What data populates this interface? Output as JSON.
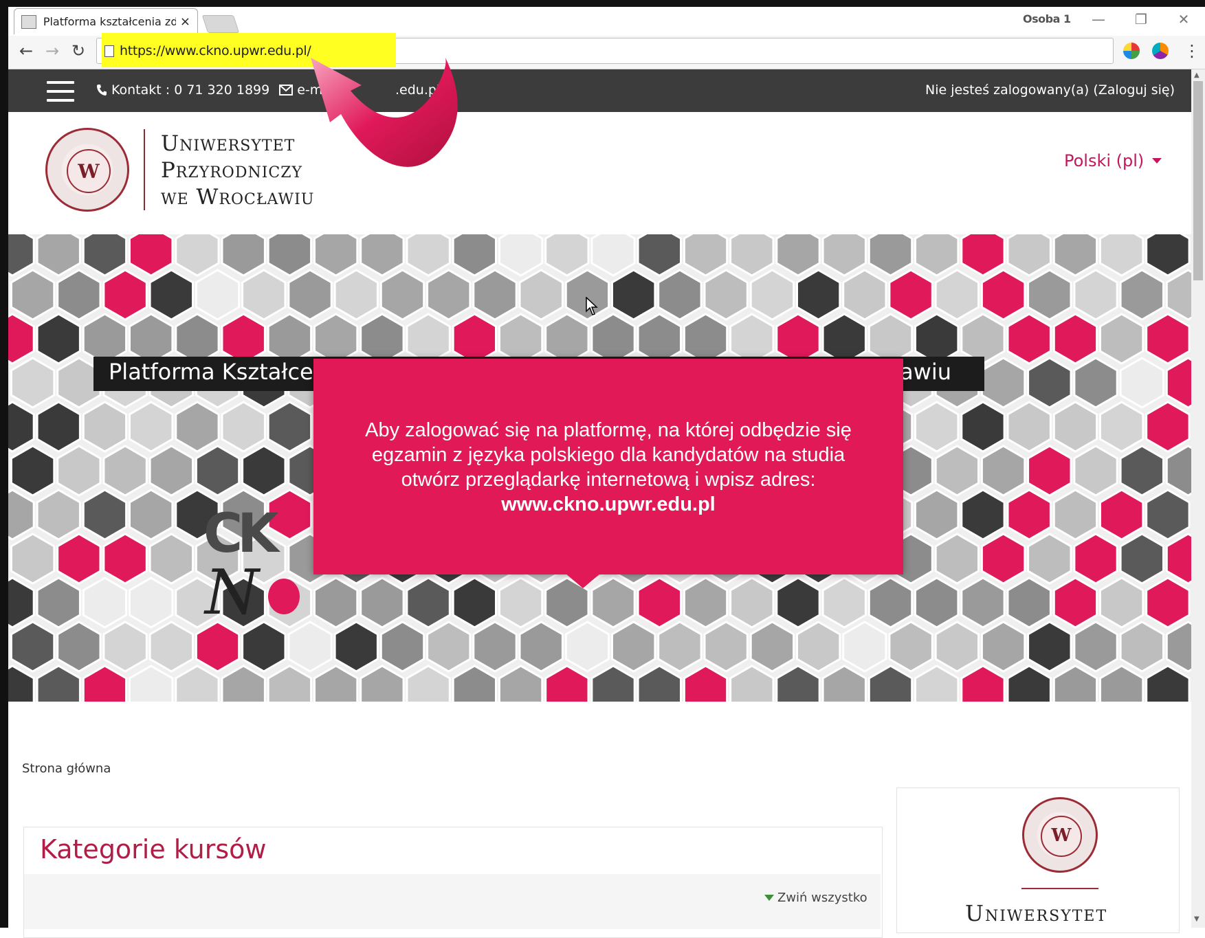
{
  "browser": {
    "tab_title": "Platforma kształcenia zd",
    "tab_close": "×",
    "profile": "Osoba 1",
    "minimize": "—",
    "restore": "❐",
    "close": "✕",
    "back": "←",
    "forward": "→",
    "reload": "↻",
    "url": "https://www.ckno.upwr.edu.pl/",
    "menu": "⋮"
  },
  "site": {
    "contact": "Kontakt : 0 71 320 1899",
    "email_label": "e-mail",
    "email_tail": ".edu.pl",
    "login_status": "Nie jesteś zalogowany(a) (Zaloguj się)",
    "university": [
      "Uniwersytet",
      "Przyrodniczy",
      "we Wrocławiu"
    ],
    "seal_letter": "W",
    "language": "Polski (pl)"
  },
  "banner": {
    "title_left": "Platforma Kształce",
    "title_right": "ławiu",
    "logo_ck": "CK",
    "logo_n": "N"
  },
  "overlay": {
    "lines": [
      "Aby zalogować się na platformę, na której odbędzie się",
      "egzamin z języka polskiego dla kandydatów na studia",
      "otwórz przeglądarkę internetową i wpisz adres:"
    ],
    "url": "www.ckno.upwr.edu.pl"
  },
  "content": {
    "breadcrumb": "Strona główna",
    "course_title": "Kategorie kursów",
    "collapse_all": "Zwiń wszystko",
    "side_uni": "Uniwersytet"
  },
  "colors": {
    "accent_pink": "#e11a57",
    "brand_maroon": "#9b2c36",
    "header_bar": "#3c3c3c",
    "url_highlight": "#ffff22"
  }
}
